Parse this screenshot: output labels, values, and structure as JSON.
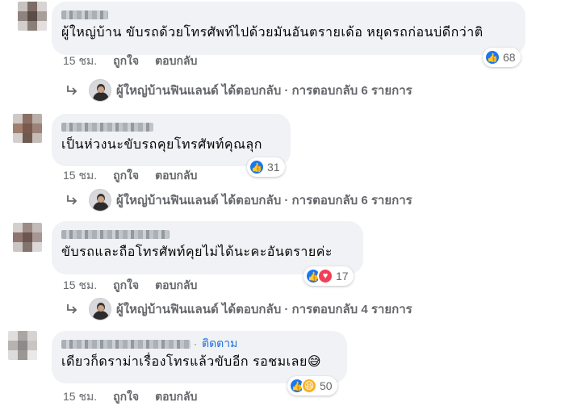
{
  "comments": [
    {
      "text": "ผู้ใหญ่บ้าน ขับรถด้วยโทรศัพท์ไปด้วยมันอันตรายเด้อ หยุดรถก่อนบ่ดีกว่าติ",
      "time": "15 ชม.",
      "like_label": "ถูกใจ",
      "reply_label": "ตอบกลับ",
      "reaction_count": "68",
      "reactions": [
        "like-icon"
      ],
      "reply_summary": "ผู้ใหญ่บ้านฟินแลนด์ ได้ตอบกลับ · การตอบกลับ 6 รายการ"
    },
    {
      "text": "เป็นห่วงนะขับรถคุยโทรศัพท์คุณลุก",
      "time": "15 ชม.",
      "like_label": "ถูกใจ",
      "reply_label": "ตอบกลับ",
      "reaction_count": "31",
      "reactions": [
        "like-icon"
      ],
      "reply_summary": "ผู้ใหญ่บ้านฟินแลนด์ ได้ตอบกลับ · การตอบกลับ 6 รายการ"
    },
    {
      "text": "ขับรถและถือโทรศัพท์คุยไม่ได้นะคะอันตรายค่ะ",
      "time": "15 ชม.",
      "like_label": "ถูกใจ",
      "reply_label": "ตอบกลับ",
      "reaction_count": "17",
      "reactions": [
        "like-icon",
        "love-icon"
      ],
      "reply_summary": "ผู้ใหญ่บ้านฟินแลนด์ ได้ตอบกลับ · การตอบกลับ 4 รายการ"
    },
    {
      "follow_label": "ติดตาม",
      "text": "เดียวก็ดราม่าเรื่องโทรแล้วขับอีก รอชมเลย😅",
      "time": "15 ชม.",
      "like_label": "ถูกใจ",
      "reply_label": "ตอบกลับ",
      "reaction_count": "50",
      "reactions": [
        "like-icon",
        "haha-icon"
      ]
    }
  ],
  "colors": {
    "bubble": "#f0f2f5",
    "like": "#1877f2",
    "love": "#f33e58",
    "haha": "#f7b125",
    "follow": "#216fdb",
    "meta": "#65676b"
  }
}
